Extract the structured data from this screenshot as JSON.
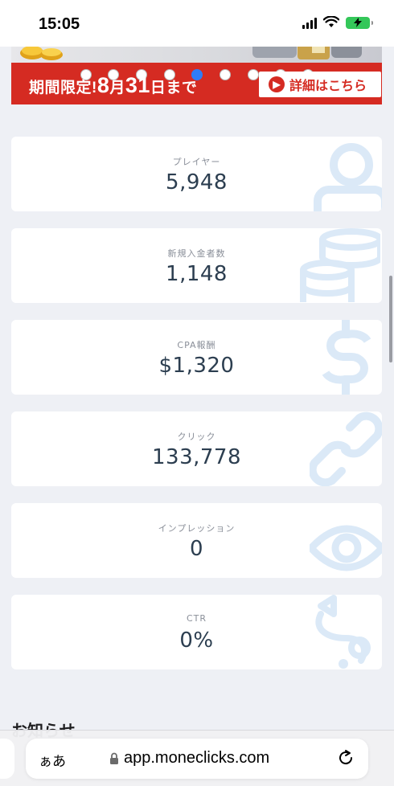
{
  "status_bar": {
    "time": "15:05",
    "battery": "charging"
  },
  "banner": {
    "text_prefix": "期間限定!",
    "month": "8",
    "month_unit": "月",
    "day": "31",
    "day_unit": "日まで",
    "button_label": "詳細はこちら",
    "colors": {
      "background": "#d52b22",
      "button_text": "#d52b22"
    }
  },
  "stats": [
    {
      "label": "プレイヤー",
      "value": "5,948",
      "icon": "user-icon"
    },
    {
      "label": "新規入金者数",
      "value": "1,148",
      "icon": "coins-icon"
    },
    {
      "label": "CPA報酬",
      "value": "$1,320",
      "icon": "dollar-icon"
    },
    {
      "label": "クリック",
      "value": "133,778",
      "icon": "link-icon"
    },
    {
      "label": "インプレッション",
      "value": "0",
      "icon": "eye-icon"
    },
    {
      "label": "CTR",
      "value": "0%",
      "icon": "route-icon"
    }
  ],
  "news": {
    "heading": "お知らせ"
  },
  "browser": {
    "aa_label": "ぁあ",
    "url": "app.moneclicks.com"
  },
  "colors": {
    "page_bg": "#eef0f5",
    "card_bg": "#ffffff",
    "icon_tint": "#dbe9f7",
    "value_text": "#2c3e50"
  }
}
